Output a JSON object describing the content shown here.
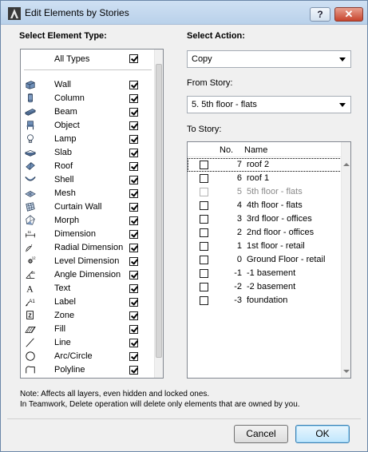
{
  "window": {
    "title": "Edit Elements by Stories",
    "help_label": "?",
    "close_label": "✕"
  },
  "left": {
    "heading": "Select Element Type:",
    "all_types": {
      "label": "All Types",
      "checked": true
    },
    "elements": [
      {
        "label": "Wall",
        "icon": "wall-icon",
        "checked": true
      },
      {
        "label": "Column",
        "icon": "column-icon",
        "checked": true
      },
      {
        "label": "Beam",
        "icon": "beam-icon",
        "checked": true
      },
      {
        "label": "Object",
        "icon": "object-icon",
        "checked": true
      },
      {
        "label": "Lamp",
        "icon": "lamp-icon",
        "checked": true
      },
      {
        "label": "Slab",
        "icon": "slab-icon",
        "checked": true
      },
      {
        "label": "Roof",
        "icon": "roof-icon",
        "checked": true
      },
      {
        "label": "Shell",
        "icon": "shell-icon",
        "checked": true
      },
      {
        "label": "Mesh",
        "icon": "mesh-icon",
        "checked": true
      },
      {
        "label": "Curtain Wall",
        "icon": "curtain-wall-icon",
        "checked": true
      },
      {
        "label": "Morph",
        "icon": "morph-icon",
        "checked": true
      },
      {
        "label": "Dimension",
        "icon": "dimension-icon",
        "checked": true
      },
      {
        "label": "Radial Dimension",
        "icon": "radial-dimension-icon",
        "checked": true
      },
      {
        "label": "Level Dimension",
        "icon": "level-dimension-icon",
        "checked": true
      },
      {
        "label": "Angle Dimension",
        "icon": "angle-dimension-icon",
        "checked": true
      },
      {
        "label": "Text",
        "icon": "text-icon",
        "checked": true
      },
      {
        "label": "Label",
        "icon": "label-icon",
        "checked": true
      },
      {
        "label": "Zone",
        "icon": "zone-icon",
        "checked": true
      },
      {
        "label": "Fill",
        "icon": "fill-icon",
        "checked": true
      },
      {
        "label": "Line",
        "icon": "line-icon",
        "checked": true
      },
      {
        "label": "Arc/Circle",
        "icon": "arc-circle-icon",
        "checked": true
      },
      {
        "label": "Polyline",
        "icon": "polyline-icon",
        "checked": true
      }
    ]
  },
  "right": {
    "heading": "Select Action:",
    "action": {
      "value": "Copy"
    },
    "from_story": {
      "label": "From Story:",
      "value": "5. 5th floor - flats"
    },
    "to_story": {
      "label": "To Story:",
      "col_no": "No.",
      "col_name": "Name",
      "rows": [
        {
          "no": "7",
          "name": "roof 2",
          "checked": false,
          "disabled": false
        },
        {
          "no": "6",
          "name": "roof 1",
          "checked": false,
          "disabled": false
        },
        {
          "no": "5",
          "name": "5th floor - flats",
          "checked": false,
          "disabled": true
        },
        {
          "no": "4",
          "name": "4th floor - flats",
          "checked": false,
          "disabled": false
        },
        {
          "no": "3",
          "name": "3rd floor - offices",
          "checked": false,
          "disabled": false
        },
        {
          "no": "2",
          "name": "2nd floor - offices",
          "checked": false,
          "disabled": false
        },
        {
          "no": "1",
          "name": "1st floor - retail",
          "checked": false,
          "disabled": false
        },
        {
          "no": "0",
          "name": "Ground Floor - retail",
          "checked": false,
          "disabled": false
        },
        {
          "no": "-1",
          "name": "-1 basement",
          "checked": false,
          "disabled": false
        },
        {
          "no": "-2",
          "name": "-2 basement",
          "checked": false,
          "disabled": false
        },
        {
          "no": "-3",
          "name": "foundation",
          "checked": false,
          "disabled": false
        }
      ]
    }
  },
  "notes": {
    "line1": "Note: Affects all layers, even hidden and locked ones.",
    "line2": "In Teamwork, Delete operation will delete only elements that are owned by you."
  },
  "buttons": {
    "cancel": "Cancel",
    "ok": "OK"
  }
}
